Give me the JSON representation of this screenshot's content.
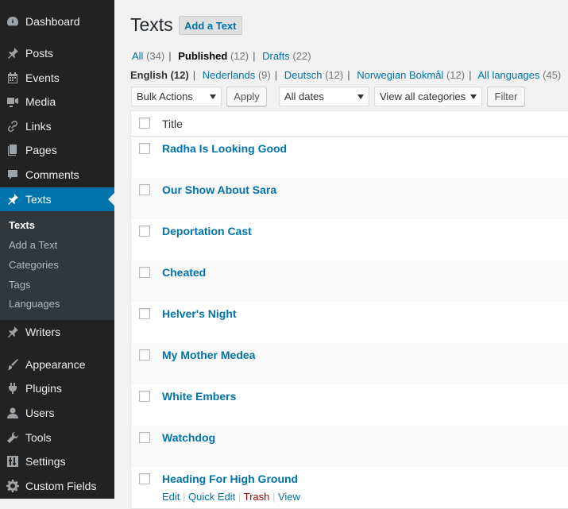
{
  "sidebar": {
    "items": [
      {
        "label": "Dashboard",
        "icon": "dashboard-icon"
      },
      {
        "label": "Posts",
        "icon": "pin-icon"
      },
      {
        "label": "Events",
        "icon": "calendar-icon"
      },
      {
        "label": "Media",
        "icon": "media-icon"
      },
      {
        "label": "Links",
        "icon": "link-icon"
      },
      {
        "label": "Pages",
        "icon": "pages-icon"
      },
      {
        "label": "Comments",
        "icon": "comment-icon"
      },
      {
        "label": "Texts",
        "icon": "pin-icon"
      },
      {
        "label": "Writers",
        "icon": "pin-icon"
      },
      {
        "label": "Appearance",
        "icon": "paintbrush-icon"
      },
      {
        "label": "Plugins",
        "icon": "plugin-icon"
      },
      {
        "label": "Users",
        "icon": "user-icon"
      },
      {
        "label": "Tools",
        "icon": "wrench-icon"
      },
      {
        "label": "Settings",
        "icon": "settings-icon"
      },
      {
        "label": "Custom Fields",
        "icon": "gear-icon"
      }
    ],
    "submenu": [
      "Texts",
      "Add a Text",
      "Categories",
      "Tags",
      "Languages"
    ],
    "accent_color": "#0073aa"
  },
  "header": {
    "title": "Texts",
    "add_button": "Add a Text"
  },
  "status_filters": {
    "all_label": "All",
    "all_count": "(34)",
    "published_label": "Published",
    "published_count": "(12)",
    "drafts_label": "Drafts",
    "drafts_count": "(22)"
  },
  "language_filters": {
    "english_label": "English",
    "english_count": "(12)",
    "nl_label": "Nederlands",
    "nl_count": "(9)",
    "de_label": "Deutsch",
    "de_count": "(12)",
    "nb_label": "Norwegian Bokmål",
    "nb_count": "(12)",
    "all_label": "All languages",
    "all_count": "(45)"
  },
  "toolbar": {
    "bulk_actions": "Bulk Actions",
    "apply": "Apply",
    "dates": "All dates",
    "categories": "View all categories",
    "filter": "Filter"
  },
  "table": {
    "column_title": "Title",
    "rows": [
      "Radha Is Looking Good",
      "Our Show About Sara",
      "Deportation Cast",
      "Cheated",
      "Helver's Night",
      "My Mother Medea",
      "White Embers",
      "Watchdog",
      "Heading For High Ground"
    ],
    "row_actions": {
      "edit": "Edit",
      "quick_edit": "Quick Edit",
      "trash": "Trash",
      "view": "View"
    }
  }
}
